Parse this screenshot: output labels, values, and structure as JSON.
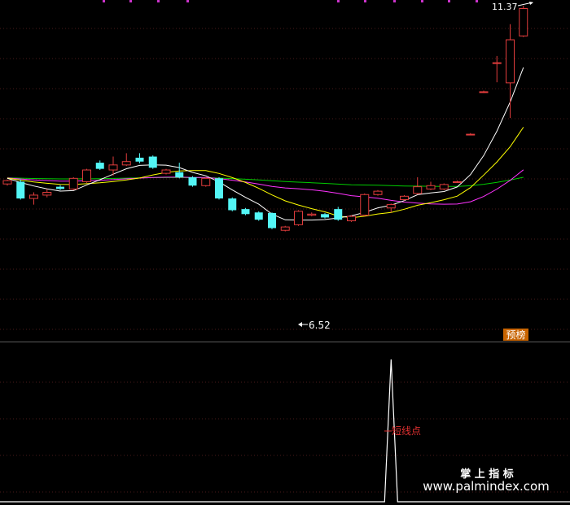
{
  "colors": {
    "background": "#000000",
    "grid": "#4a1a1a",
    "up": "#e03c3c",
    "down": "#53f6f6",
    "ma5": "#ffffff",
    "ma10": "#ffff00",
    "ma20": "#ff33ff",
    "ma60": "#00cc00",
    "signal": "#ffffff",
    "annotation": "#ffffff",
    "signal_label": "#e03030",
    "badge_bg": "#c86400",
    "watermark": "#ffffff"
  },
  "annotations": {
    "high_label": "11.37",
    "low_label": "6.52",
    "signal_label": "短线点",
    "badge": "预榜"
  },
  "watermark": {
    "line1": "掌 上 指 标",
    "line2": "www.palmindex.com"
  },
  "chart_data": [
    {
      "type": "candlestick",
      "title": "",
      "ylim": [
        5.7,
        11.45
      ],
      "grid": true,
      "candles": [
        {
          "o": 8.23,
          "c": 8.29,
          "h": 8.31,
          "l": 8.2
        },
        {
          "o": 8.27,
          "c": 7.97,
          "h": 8.31,
          "l": 7.95
        },
        {
          "o": 7.97,
          "c": 8.03,
          "h": 8.08,
          "l": 7.86
        },
        {
          "o": 8.03,
          "c": 8.08,
          "h": 8.14,
          "l": 7.99
        },
        {
          "o": 8.18,
          "c": 8.14,
          "h": 8.21,
          "l": 8.12
        },
        {
          "o": 8.14,
          "c": 8.33,
          "h": 8.35,
          "l": 8.12
        },
        {
          "o": 8.27,
          "c": 8.48,
          "h": 8.5,
          "l": 8.25
        },
        {
          "o": 8.61,
          "c": 8.5,
          "h": 8.65,
          "l": 8.48
        },
        {
          "o": 8.48,
          "c": 8.57,
          "h": 8.72,
          "l": 8.38
        },
        {
          "o": 8.57,
          "c": 8.63,
          "h": 8.78,
          "l": 8.55
        },
        {
          "o": 8.7,
          "c": 8.63,
          "h": 8.78,
          "l": 8.6
        },
        {
          "o": 8.72,
          "c": 8.52,
          "h": 8.74,
          "l": 8.5
        },
        {
          "o": 8.42,
          "c": 8.48,
          "h": 8.5,
          "l": 8.4
        },
        {
          "o": 8.44,
          "c": 8.35,
          "h": 8.61,
          "l": 8.33
        },
        {
          "o": 8.35,
          "c": 8.2,
          "h": 8.37,
          "l": 8.18
        },
        {
          "o": 8.2,
          "c": 8.33,
          "h": 8.35,
          "l": 8.18
        },
        {
          "o": 8.33,
          "c": 7.97,
          "h": 8.35,
          "l": 7.95
        },
        {
          "o": 7.97,
          "c": 7.76,
          "h": 7.99,
          "l": 7.74
        },
        {
          "o": 7.78,
          "c": 7.69,
          "h": 7.8,
          "l": 7.67
        },
        {
          "o": 7.72,
          "c": 7.59,
          "h": 7.74,
          "l": 7.57
        },
        {
          "o": 7.71,
          "c": 7.44,
          "h": 7.72,
          "l": 7.42
        },
        {
          "o": 7.4,
          "c": 7.46,
          "h": 7.48,
          "l": 7.38
        },
        {
          "o": 7.5,
          "c": 7.74,
          "h": 7.76,
          "l": 7.48
        },
        {
          "o": 7.67,
          "c": 7.69,
          "h": 7.72,
          "l": 7.65
        },
        {
          "o": 7.69,
          "c": 7.63,
          "h": 7.71,
          "l": 7.61
        },
        {
          "o": 7.78,
          "c": 7.59,
          "h": 7.82,
          "l": 7.57
        },
        {
          "o": 7.57,
          "c": 7.65,
          "h": 7.67,
          "l": 7.55
        },
        {
          "o": 7.67,
          "c": 8.04,
          "h": 8.06,
          "l": 7.65
        },
        {
          "o": 8.04,
          "c": 8.1,
          "h": 8.12,
          "l": 8.02
        },
        {
          "o": 7.8,
          "c": 7.86,
          "h": 7.88,
          "l": 7.72
        },
        {
          "o": 7.95,
          "c": 8.01,
          "h": 8.03,
          "l": 7.93
        },
        {
          "o": 8.06,
          "c": 8.18,
          "h": 8.35,
          "l": 8.04
        },
        {
          "o": 8.14,
          "c": 8.2,
          "h": 8.27,
          "l": 8.12
        },
        {
          "o": 8.14,
          "c": 8.22,
          "h": 8.24,
          "l": 8.12
        },
        {
          "o": 8.27,
          "c": 8.27,
          "h": 8.29,
          "l": 8.25
        },
        {
          "o": 9.12,
          "c": 9.12,
          "h": 9.14,
          "l": 9.1
        },
        {
          "o": 9.88,
          "c": 9.88,
          "h": 9.9,
          "l": 9.86
        },
        {
          "o": 10.4,
          "c": 10.4,
          "h": 10.52,
          "l": 10.05
        },
        {
          "o": 10.04,
          "c": 10.81,
          "h": 11.09,
          "l": 9.41
        },
        {
          "o": 10.88,
          "c": 11.37,
          "h": 11.42,
          "l": 10.86
        }
      ]
    },
    {
      "type": "line",
      "title": "",
      "ylim": [
        0,
        1
      ],
      "series": [
        {
          "values": [
            0,
            0,
            0,
            0,
            0,
            0,
            0,
            0,
            0,
            0,
            0,
            0,
            0,
            0,
            0,
            0,
            0,
            0,
            0,
            0,
            0,
            0,
            0,
            0,
            0,
            0,
            0,
            0,
            0,
            1,
            0,
            0,
            0,
            0,
            0,
            0,
            0,
            0,
            0,
            0
          ]
        }
      ]
    }
  ]
}
